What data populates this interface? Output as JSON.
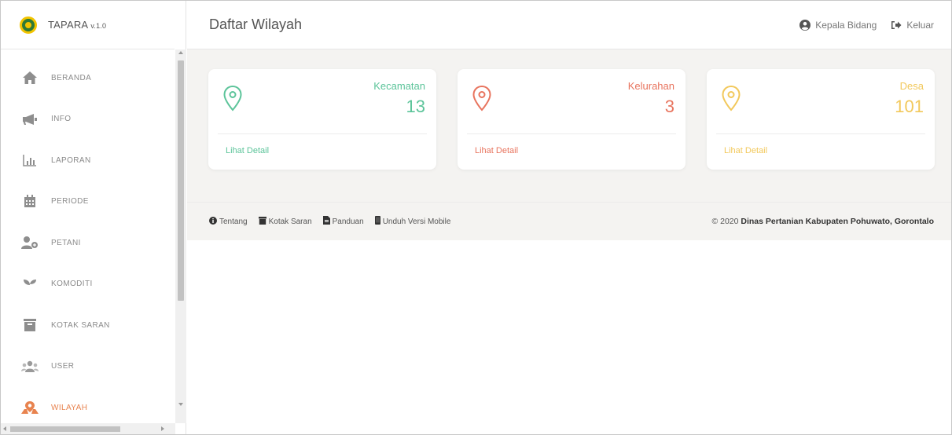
{
  "app": {
    "name": "TAPARA",
    "version": "v.1.0"
  },
  "sidebar": {
    "items": [
      {
        "label": "BERANDA",
        "icon": "home-icon"
      },
      {
        "label": "INFO",
        "icon": "megaphone-icon"
      },
      {
        "label": "LAPORAN",
        "icon": "bar-chart-icon"
      },
      {
        "label": "PERIODE",
        "icon": "calendar-icon"
      },
      {
        "label": "PETANI",
        "icon": "farmer-users-icon"
      },
      {
        "label": "KOMODITI",
        "icon": "seedling-icon"
      },
      {
        "label": "KOTAK SARAN",
        "icon": "archive-box-icon"
      },
      {
        "label": "USER",
        "icon": "users-group-icon"
      },
      {
        "label": "WILAYAH",
        "icon": "map-pin-icon",
        "active": true
      }
    ]
  },
  "header": {
    "title": "Daftar Wilayah",
    "user_label": "Kepala Bidang",
    "logout_label": "Keluar"
  },
  "cards": [
    {
      "name": "Kecamatan",
      "count": "13",
      "detail": "Lihat Detail",
      "color": "#5cc49a"
    },
    {
      "name": "Kelurahan",
      "count": "3",
      "detail": "Lihat Detail",
      "color": "#e8745e"
    },
    {
      "name": "Desa",
      "count": "101",
      "detail": "Lihat Detail",
      "color": "#f2c85b"
    }
  ],
  "footer": {
    "links": [
      {
        "label": "Tentang",
        "icon": "info-circle-icon"
      },
      {
        "label": "Kotak Saran",
        "icon": "archive-icon"
      },
      {
        "label": "Panduan",
        "icon": "pdf-file-icon"
      },
      {
        "label": "Unduh Versi Mobile",
        "icon": "mobile-icon"
      }
    ],
    "copyright_prefix": "© 2020",
    "copyright_org": "Dinas Pertanian Kabupaten Pohuwato, Gorontalo"
  },
  "colors": {
    "active_menu": "#e8834f",
    "content_bg": "#f4f3f1"
  }
}
